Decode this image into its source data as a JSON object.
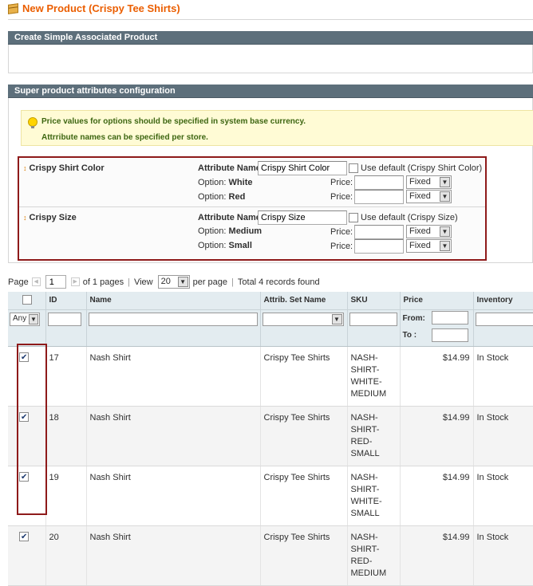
{
  "page": {
    "title": "New Product (Crispy Tee Shirts)"
  },
  "section_simple": {
    "heading": "Create Simple Associated Product"
  },
  "section_super": {
    "heading": "Super product attributes configuration",
    "notice_1": "Price values for options should be specified in system base currency.",
    "notice_2": "Attrribute names can be specified per store."
  },
  "attributes": [
    {
      "name": "Crispy Shirt Color",
      "attr_name_label": "Attribute Name:",
      "attr_name_value": "Crispy Shirt Color",
      "use_default_label": "Use default (Crispy Shirt Color)",
      "options": [
        {
          "label": "Option:",
          "value": "White",
          "price_label": "Price:",
          "price_type": "Fixed"
        },
        {
          "label": "Option:",
          "value": "Red",
          "price_label": "Price:",
          "price_type": "Fixed"
        }
      ]
    },
    {
      "name": "Crispy Size",
      "attr_name_label": "Attribute Name:",
      "attr_name_value": "Crispy Size",
      "use_default_label": "Use default (Crispy Size)",
      "options": [
        {
          "label": "Option:",
          "value": "Medium",
          "price_label": "Price:",
          "price_type": "Fixed"
        },
        {
          "label": "Option:",
          "value": "Small",
          "price_label": "Price:",
          "price_type": "Fixed"
        }
      ]
    }
  ],
  "pager": {
    "page_label": "Page",
    "page_value": "1",
    "of_pages": "of 1 pages",
    "view_label": "View",
    "per_page_value": "20",
    "per_page_label": "per page",
    "total": "Total 4 records found"
  },
  "grid": {
    "columns": [
      "",
      "ID",
      "Name",
      "Attrib. Set Name",
      "SKU",
      "Price",
      "Inventory"
    ],
    "filter_any": "Any",
    "price_from": "From:",
    "price_to": "To :",
    "rows": [
      {
        "checked": true,
        "id": "17",
        "name": "Nash Shirt",
        "set": "Crispy Tee Shirts",
        "sku": [
          "NASH-",
          "SHIRT-",
          "WHITE-",
          "MEDIUM"
        ],
        "price": "$14.99",
        "inventory": "In Stock"
      },
      {
        "checked": true,
        "id": "18",
        "name": "Nash Shirt",
        "set": "Crispy Tee Shirts",
        "sku": [
          "NASH-",
          "SHIRT-RED-",
          "SMALL"
        ],
        "price": "$14.99",
        "inventory": "In Stock"
      },
      {
        "checked": true,
        "id": "19",
        "name": "Nash Shirt",
        "set": "Crispy Tee Shirts",
        "sku": [
          "NASH-",
          "SHIRT-",
          "WHITE-",
          "SMALL"
        ],
        "price": "$14.99",
        "inventory": "In Stock"
      },
      {
        "checked": true,
        "id": "20",
        "name": "Nash Shirt",
        "set": "Crispy Tee Shirts",
        "sku": [
          "NASH-",
          "SHIRT-RED-",
          "MEDIUM"
        ],
        "price": "$14.99",
        "inventory": "In Stock"
      }
    ]
  }
}
